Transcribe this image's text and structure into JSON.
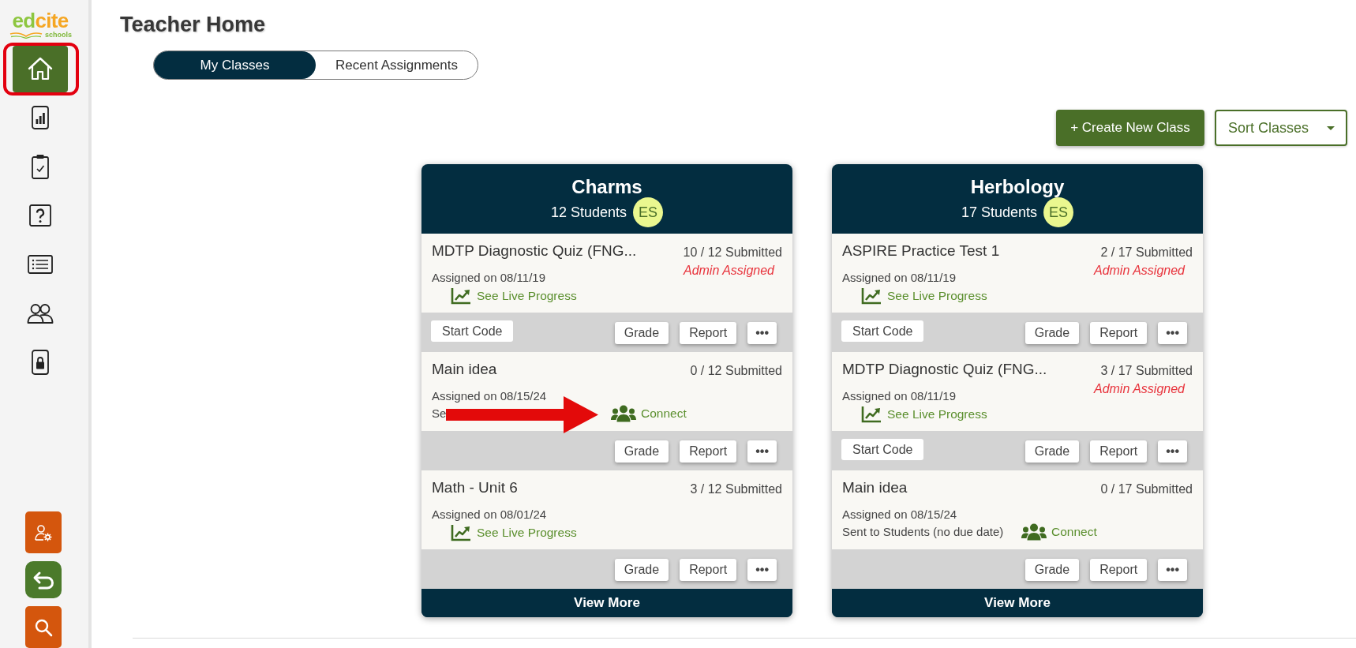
{
  "sidebar": {
    "logo": {
      "parts": [
        {
          "text": "ed",
          "color": "#8dc63f"
        },
        {
          "text": "cite",
          "color": "#f5a623"
        }
      ],
      "tagline": "schools"
    },
    "nav": [
      {
        "kind": "home",
        "selected": true,
        "highlighted": true
      },
      {
        "kind": "chart",
        "selected": false,
        "highlighted": false
      },
      {
        "kind": "clipboard",
        "selected": false,
        "highlighted": false
      },
      {
        "kind": "question",
        "selected": false,
        "highlighted": false
      },
      {
        "kind": "list",
        "selected": false,
        "highlighted": false
      },
      {
        "kind": "people",
        "selected": false,
        "highlighted": false
      },
      {
        "kind": "lock",
        "selected": false,
        "highlighted": false
      }
    ],
    "bottom_buttons": [
      {
        "kind": "user-settings",
        "color": "#d4560d"
      },
      {
        "kind": "back",
        "color": "#4b7a2b"
      },
      {
        "kind": "search",
        "color": "#d4560d"
      }
    ]
  },
  "header": {
    "title": "Teacher Home"
  },
  "tabs": [
    {
      "label": "My Classes",
      "selected": true
    },
    {
      "label": "Recent Assignments",
      "selected": false
    }
  ],
  "toolbar": {
    "create_button": "+ Create New Class",
    "sort_dropdown": "Sort Classes"
  },
  "classes": [
    {
      "name": "Charms",
      "students": "12 Students",
      "teacher_initials": "ES",
      "footer_button": "View More",
      "assignments": [
        {
          "title": "MDTP Diagnostic Quiz (FNG...",
          "submitted": "10 / 12 Submitted",
          "badge": "Admin Assigned",
          "assigned": "Assigned on 08/11/19",
          "link": {
            "kind": "live-progress",
            "label": "See Live Progress"
          },
          "start_button": "Start Code",
          "buttons": [
            "Grade",
            "Report",
            "•••"
          ],
          "arrow": false
        },
        {
          "title": "Main idea",
          "submitted": "0 / 12 Submitted",
          "assigned": "Assigned on 08/15/24",
          "note": "Se",
          "link": {
            "kind": "connect",
            "label": "Connect"
          },
          "buttons": [
            "Grade",
            "Report",
            "•••"
          ],
          "arrow": true
        },
        {
          "title": "Math - Unit 6",
          "submitted": "3 / 12 Submitted",
          "assigned": "Assigned on 08/01/24",
          "link": {
            "kind": "live-progress",
            "label": "See Live Progress"
          },
          "buttons": [
            "Grade",
            "Report",
            "•••"
          ],
          "arrow": false
        }
      ]
    },
    {
      "name": "Herbology",
      "students": "17 Students",
      "teacher_initials": "ES",
      "footer_button": "View More",
      "assignments": [
        {
          "title": "ASPIRE Practice Test 1",
          "submitted": "2 / 17 Submitted",
          "badge": "Admin Assigned",
          "assigned": "Assigned on 08/11/19",
          "link": {
            "kind": "live-progress",
            "label": "See Live Progress"
          },
          "start_button": "Start Code",
          "buttons": [
            "Grade",
            "Report",
            "•••"
          ],
          "arrow": false
        },
        {
          "title": "MDTP Diagnostic Quiz (FNG...",
          "submitted": "3 / 17 Submitted",
          "badge": "Admin Assigned",
          "assigned": "Assigned on 08/11/19",
          "link": {
            "kind": "live-progress",
            "label": "See Live Progress"
          },
          "start_button": "Start Code",
          "buttons": [
            "Grade",
            "Report",
            "•••"
          ],
          "arrow": false
        },
        {
          "title": "Main idea",
          "submitted": "0 / 17 Submitted",
          "assigned": "Assigned on 08/15/24",
          "note": "Sent to Students (no due date)",
          "link": {
            "kind": "connect",
            "label": "Connect"
          },
          "buttons": [
            "Grade",
            "Report",
            "•••"
          ],
          "arrow": false
        }
      ]
    }
  ]
}
